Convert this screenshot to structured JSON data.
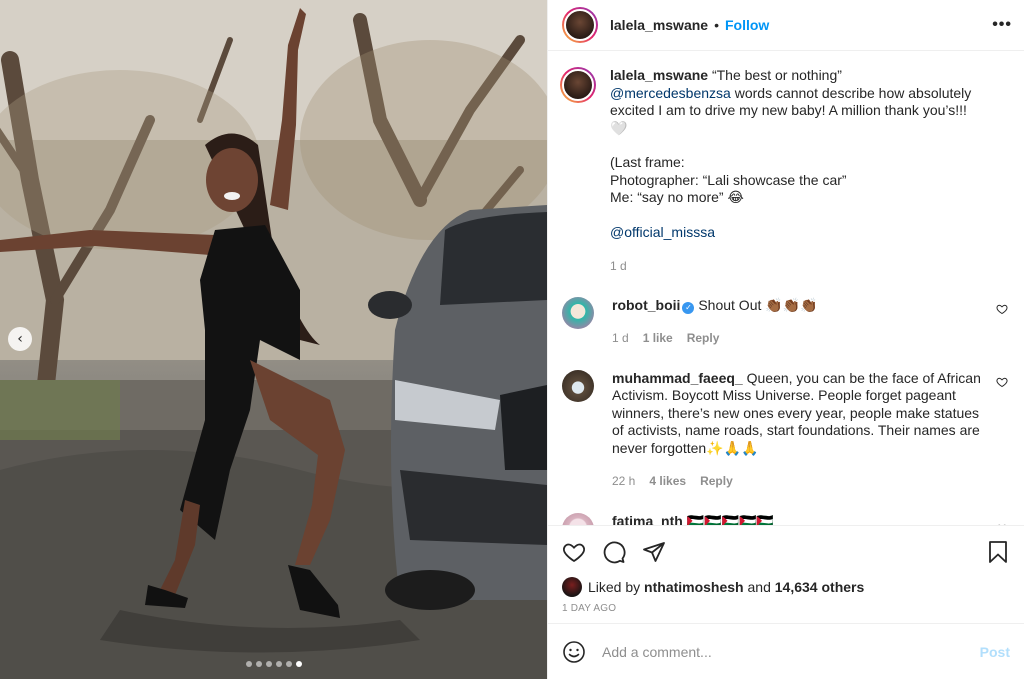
{
  "header": {
    "username": "lalela_mswane",
    "separator": "•",
    "follow_label": "Follow",
    "more_label": "•••"
  },
  "caption": {
    "username": "lalela_mswane",
    "title": "“The best or nothing”",
    "mention": "@mercedesbenzsa",
    "text": "words cannot describe how absolutely excited I am to drive my new baby! A million thank you’s!!!🤍",
    "extra": "(Last frame:\nPhotographer: “Lali showcase the car”\nMe: “say no more” 😂",
    "mention2": "@official_misssa",
    "time": "1 d"
  },
  "comments": [
    {
      "username": "robot_boii",
      "verified": true,
      "text": "Shout Out 👏🏾👏🏾👏🏾",
      "time": "1 d",
      "likes": "1 like",
      "reply": "Reply",
      "avatar_color": "#2fb7a8"
    },
    {
      "username": "muhammad_faeeq_",
      "text": "Queen, you can be the face of African Activism. Boycott Miss Universe. People forget pageant winners, there’s new ones every year, people make statues of activists, name roads, start foundations. Their names are never forgotten✨🙏🙏",
      "time": "22 h",
      "likes": "4 likes",
      "reply": "Reply",
      "avatar_color": "#5a4a3a"
    },
    {
      "username": "fatima_nth",
      "text": "🇵🇸🇵🇸🇵🇸🇵🇸🇵🇸",
      "avatar_color": "#d9b3c0"
    }
  ],
  "actions": {
    "like_icon": "heart-icon",
    "comment_icon": "comment-icon",
    "share_icon": "paper-plane-icon",
    "save_icon": "bookmark-icon"
  },
  "likes": {
    "prefix": "Liked by",
    "user": "nthatimoshesh",
    "mid": "and",
    "count": "14,634 others"
  },
  "date": "1 DAY AGO",
  "add_comment": {
    "placeholder": "Add a comment...",
    "post_label": "Post"
  },
  "carousel": {
    "prev_label": "‹",
    "slides": 6,
    "active_index": 5
  },
  "colors": {
    "accent": "#0095f6",
    "mention": "#00376b",
    "muted": "#8e8e8e",
    "post_disabled": "#b2dffc"
  }
}
